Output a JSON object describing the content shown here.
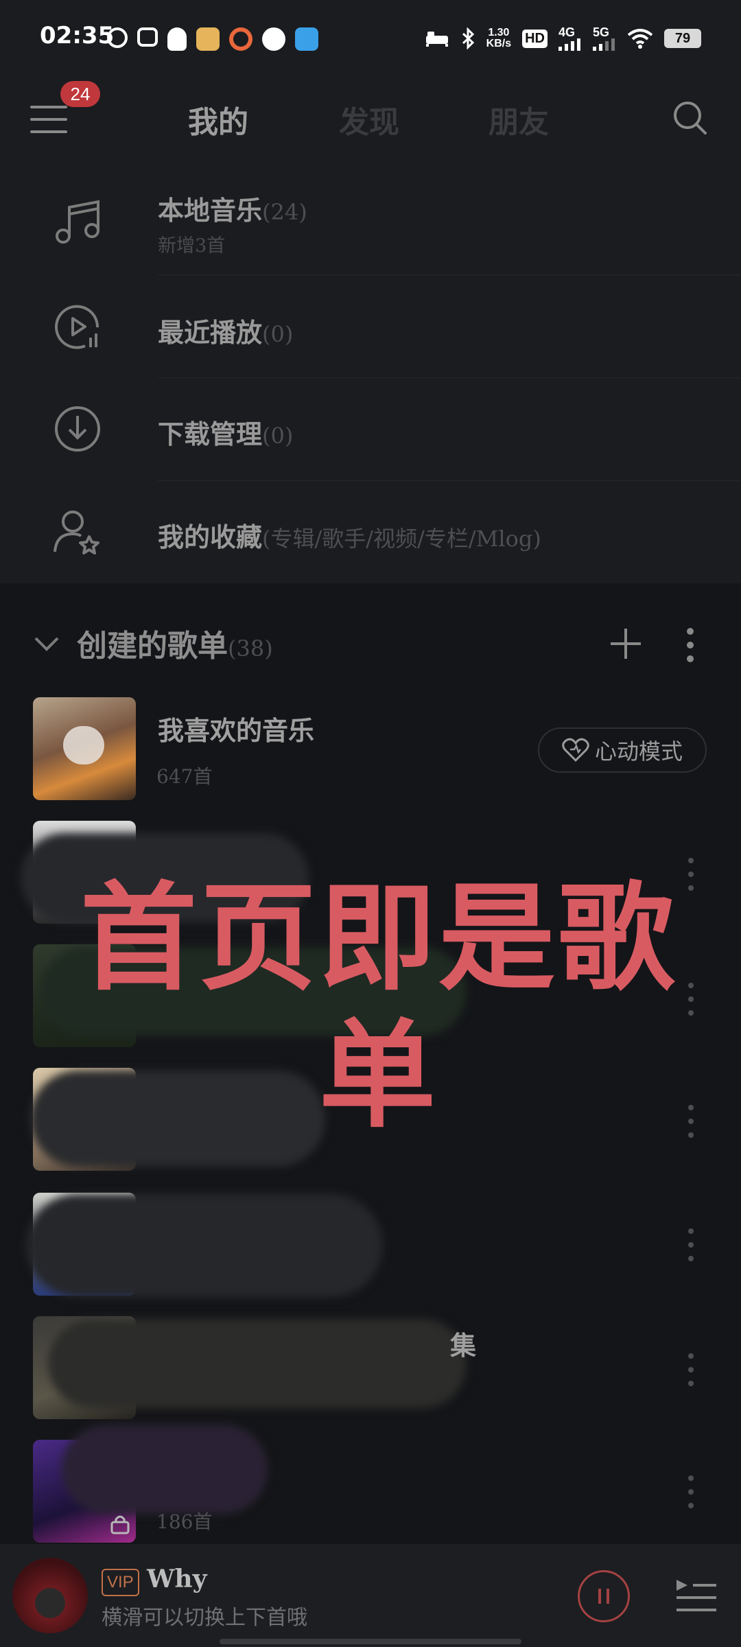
{
  "status_bar": {
    "time": "02:35",
    "network_speed_value": "1.30",
    "network_speed_unit": "KB/s",
    "hd": "HD",
    "sim1": "4G",
    "sim2": "5G",
    "battery": "79"
  },
  "header": {
    "notification_count": "24",
    "tabs": [
      {
        "label": "我的",
        "active": true
      },
      {
        "label": "发现",
        "active": false
      },
      {
        "label": "朋友",
        "active": false
      }
    ]
  },
  "quick_items": [
    {
      "icon": "music-note-icon",
      "title": "本地音乐",
      "count": "(24)",
      "subtitle": "新增3首"
    },
    {
      "icon": "recent-play-icon",
      "title": "最近播放",
      "count": "(0)"
    },
    {
      "icon": "download-icon",
      "title": "下载管理",
      "count": "(0)"
    },
    {
      "icon": "user-star-icon",
      "title": "我的收藏",
      "count": "(专辑/歌手/视频/专栏/Mlog)"
    }
  ],
  "created_playlists": {
    "title": "创建的歌单",
    "count": "(38)",
    "favorite": {
      "title": "我喜欢的音乐",
      "subtitle": "647首",
      "heart_mode_label": "心动模式"
    },
    "partial_text": {
      "title_fragment": "集",
      "subtitle_fragment": "186首"
    }
  },
  "overlay_caption": "首页即是歌单",
  "mini_player": {
    "badge": "VIP",
    "song_title": "Why",
    "hint": "横滑可以切换上下首哦"
  },
  "colors": {
    "accent_red": "#d95b62",
    "badge_red": "#c0383b",
    "background": "#141518",
    "panel": "#1b1c1f"
  }
}
